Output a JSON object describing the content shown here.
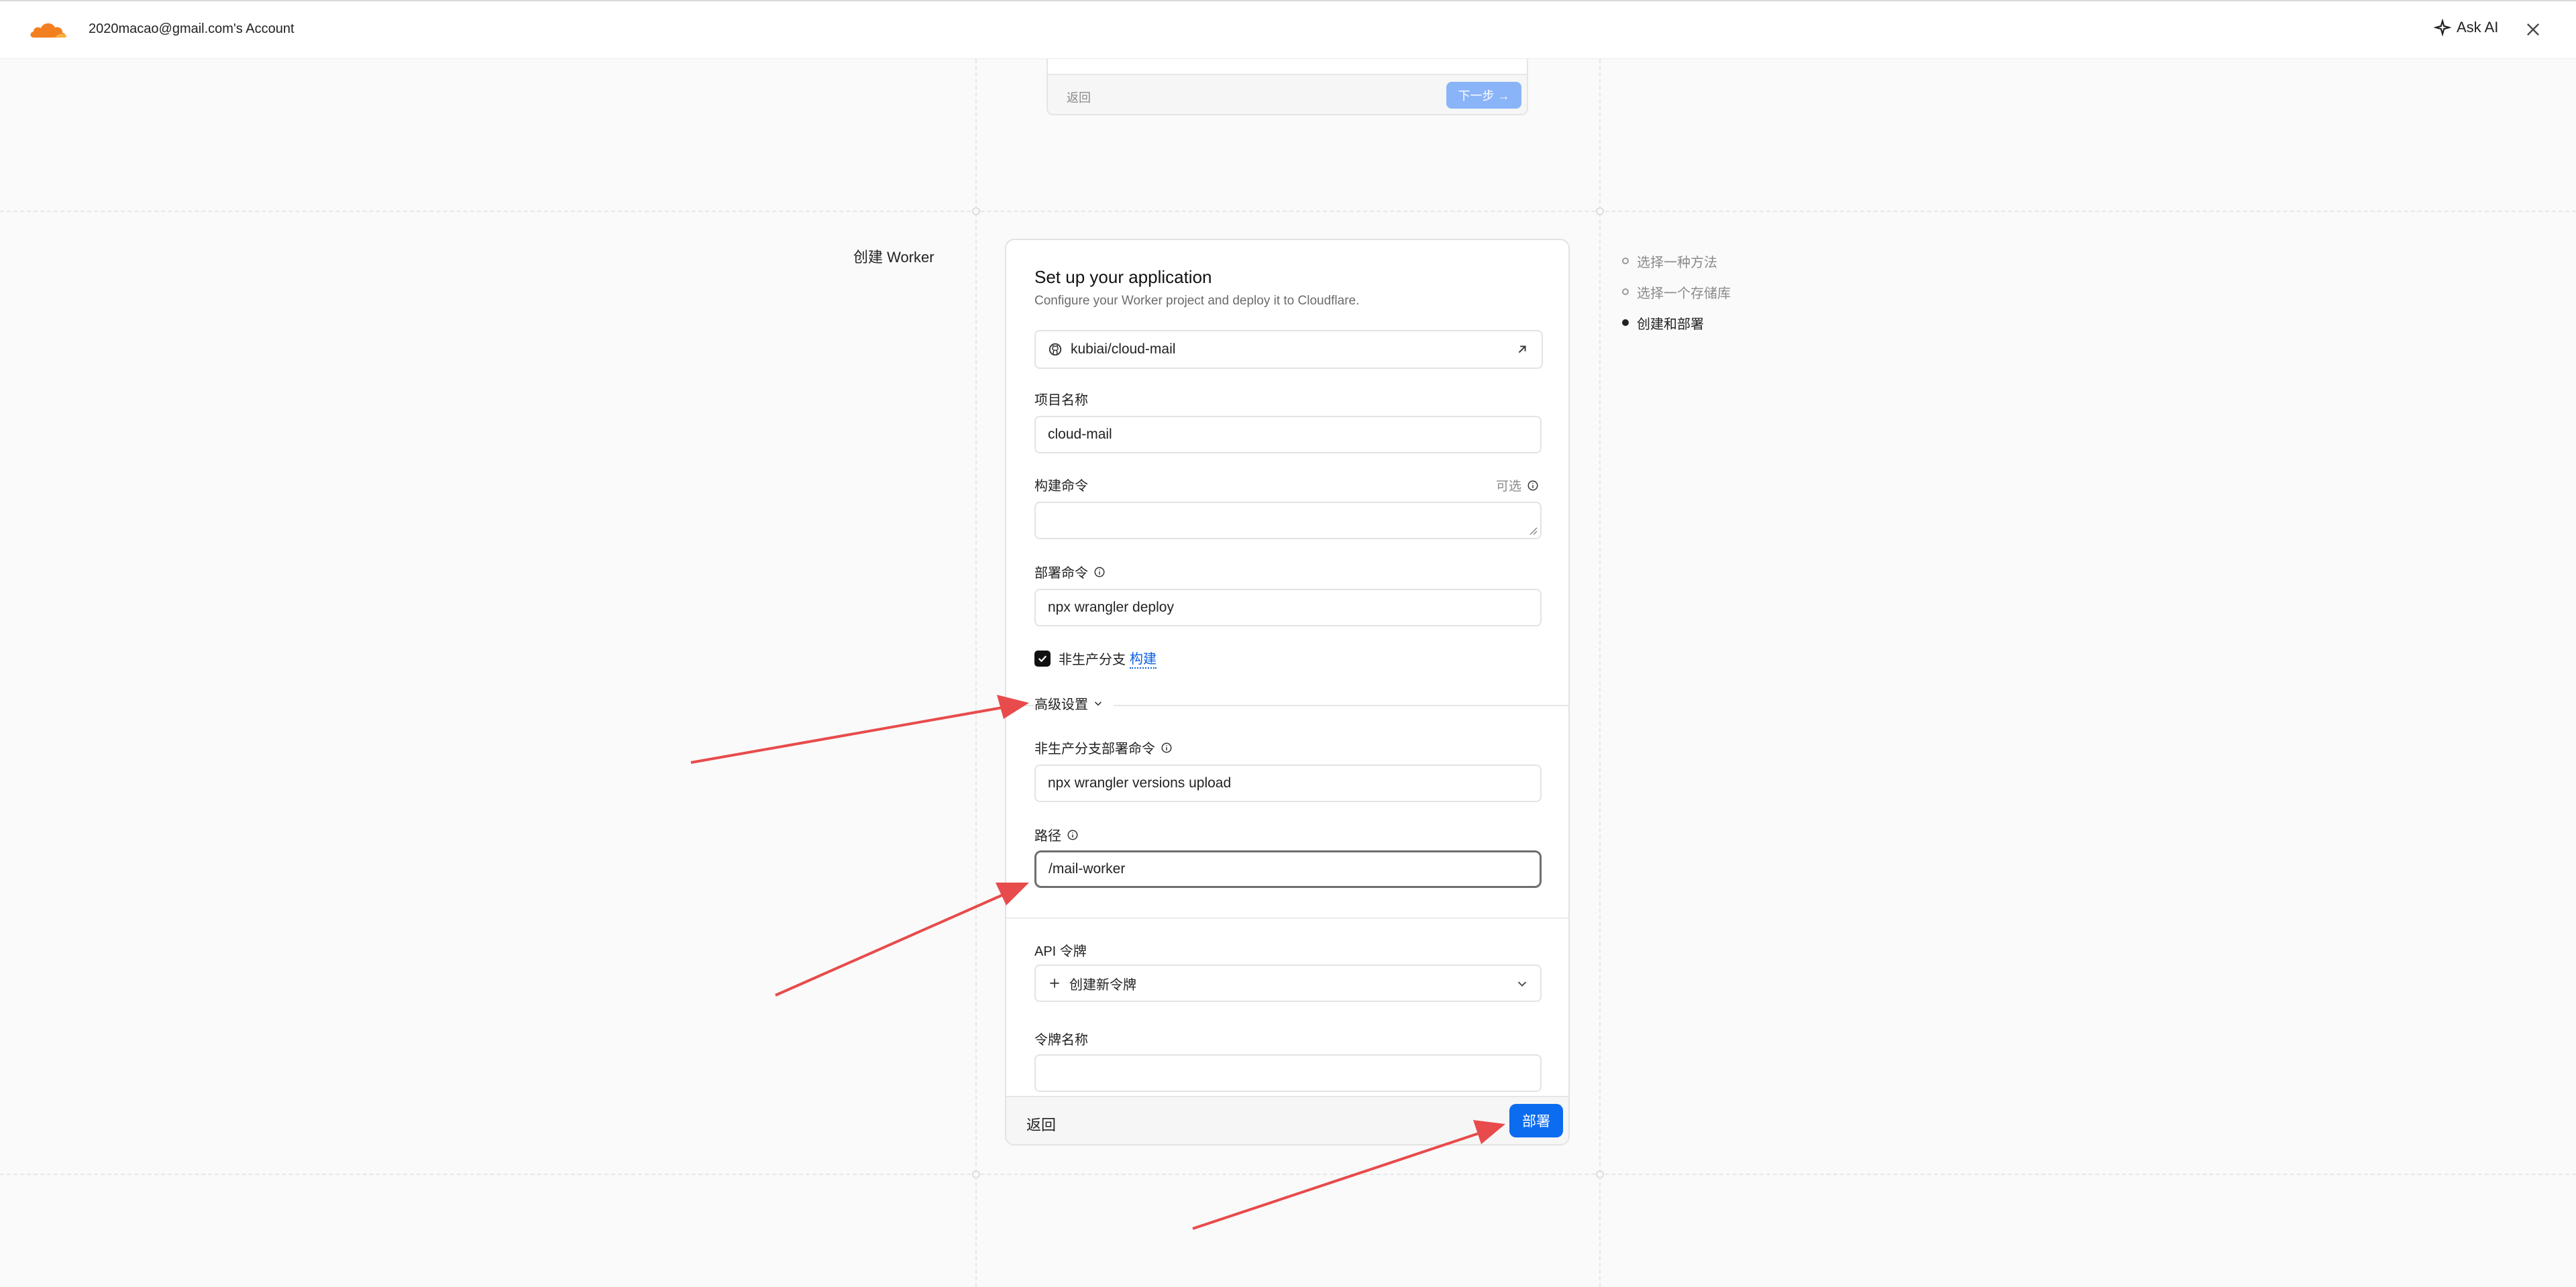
{
  "header": {
    "account": "2020macao@gmail.com's Account",
    "ask_ai": "Ask AI"
  },
  "previous_step": {
    "back_label": "返回",
    "next_label": "下一步 →"
  },
  "section_label": "创建 Worker",
  "steps": [
    {
      "label": "选择一种方法",
      "active": false
    },
    {
      "label": "选择一个存储库",
      "active": false
    },
    {
      "label": "创建和部署",
      "active": true
    }
  ],
  "form": {
    "title": "Set up your application",
    "subtitle": "Configure your Worker project and deploy it to Cloudflare.",
    "repo": "kubiai/cloud-mail",
    "project_name": {
      "label": "项目名称",
      "value": "cloud-mail"
    },
    "build_command": {
      "label": "构建命令",
      "optional": "可选",
      "value": ""
    },
    "deploy_command": {
      "label": "部署命令",
      "value": "npx wrangler deploy"
    },
    "non_prod_build": {
      "label": "非生产分支",
      "link": "构建",
      "checked": true
    },
    "advanced": {
      "label": "高级设置"
    },
    "non_prod_deploy_command": {
      "label": "非生产分支部署命令",
      "value": "npx wrangler versions upload"
    },
    "path": {
      "label": "路径",
      "value": "/mail-worker"
    },
    "api_token": {
      "label": "API 令牌",
      "value": "创建新令牌"
    },
    "token_name": {
      "label": "令牌名称",
      "value": ""
    }
  },
  "footer": {
    "back_label": "返回",
    "deploy_label": "部署"
  },
  "colors": {
    "accent": "#0b6cf0",
    "arrow": "#e84b4b",
    "cloudflare_orange": "#f38020"
  }
}
